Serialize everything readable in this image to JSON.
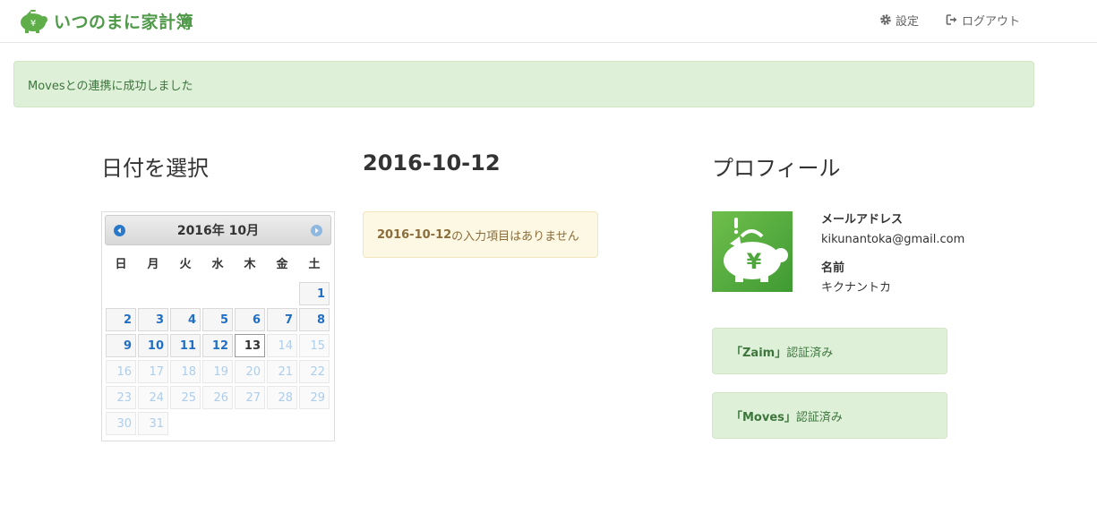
{
  "brand": {
    "name": "いつのまに家計簿",
    "logo_icon": "piggy-bank-icon",
    "color": "#4f9a48"
  },
  "nav": {
    "settings": {
      "label": "設定",
      "icon": "gear-icon"
    },
    "logout": {
      "label": "ログアウト",
      "icon": "sign-out-icon"
    }
  },
  "alert": {
    "message": "Movesとの連携に成功しました"
  },
  "calendar_section": {
    "heading": "日付を選択",
    "month_label": "2016年 10月",
    "prev_icon": "arrow-left-circle-icon",
    "next_icon": "arrow-right-circle-icon",
    "weekdays": [
      "日",
      "月",
      "火",
      "水",
      "木",
      "金",
      "土"
    ],
    "leading_blank_days": 6,
    "days": [
      "1",
      "2",
      "3",
      "4",
      "5",
      "6",
      "7",
      "8",
      "9",
      "10",
      "11",
      "12",
      "13",
      "14",
      "15",
      "16",
      "17",
      "18",
      "19",
      "20",
      "21",
      "22",
      "23",
      "24",
      "25",
      "26",
      "27",
      "28",
      "29",
      "30",
      "31"
    ],
    "today": "13"
  },
  "entries": {
    "date_heading": "2016-10-12",
    "notice_date": "2016-10-12",
    "notice_text": "の入力項目はありません"
  },
  "profile": {
    "heading": "プロフィール",
    "email_label": "メールアドレス",
    "email": "kikunantoka@gmail.com",
    "name_label": "名前",
    "name": "キクナントカ",
    "avatar_icon": "piggy-bank-yen-icon",
    "auth": [
      {
        "service": "「Zaim」",
        "status": " 認証済み"
      },
      {
        "service": "「Moves」",
        "status": " 認証済み"
      }
    ]
  },
  "colors": {
    "accent_green": "#4f9a48",
    "success_bg": "#dff0d8",
    "warning_bg": "#fcf8e3",
    "calendar_link": "#1f6fc6"
  }
}
